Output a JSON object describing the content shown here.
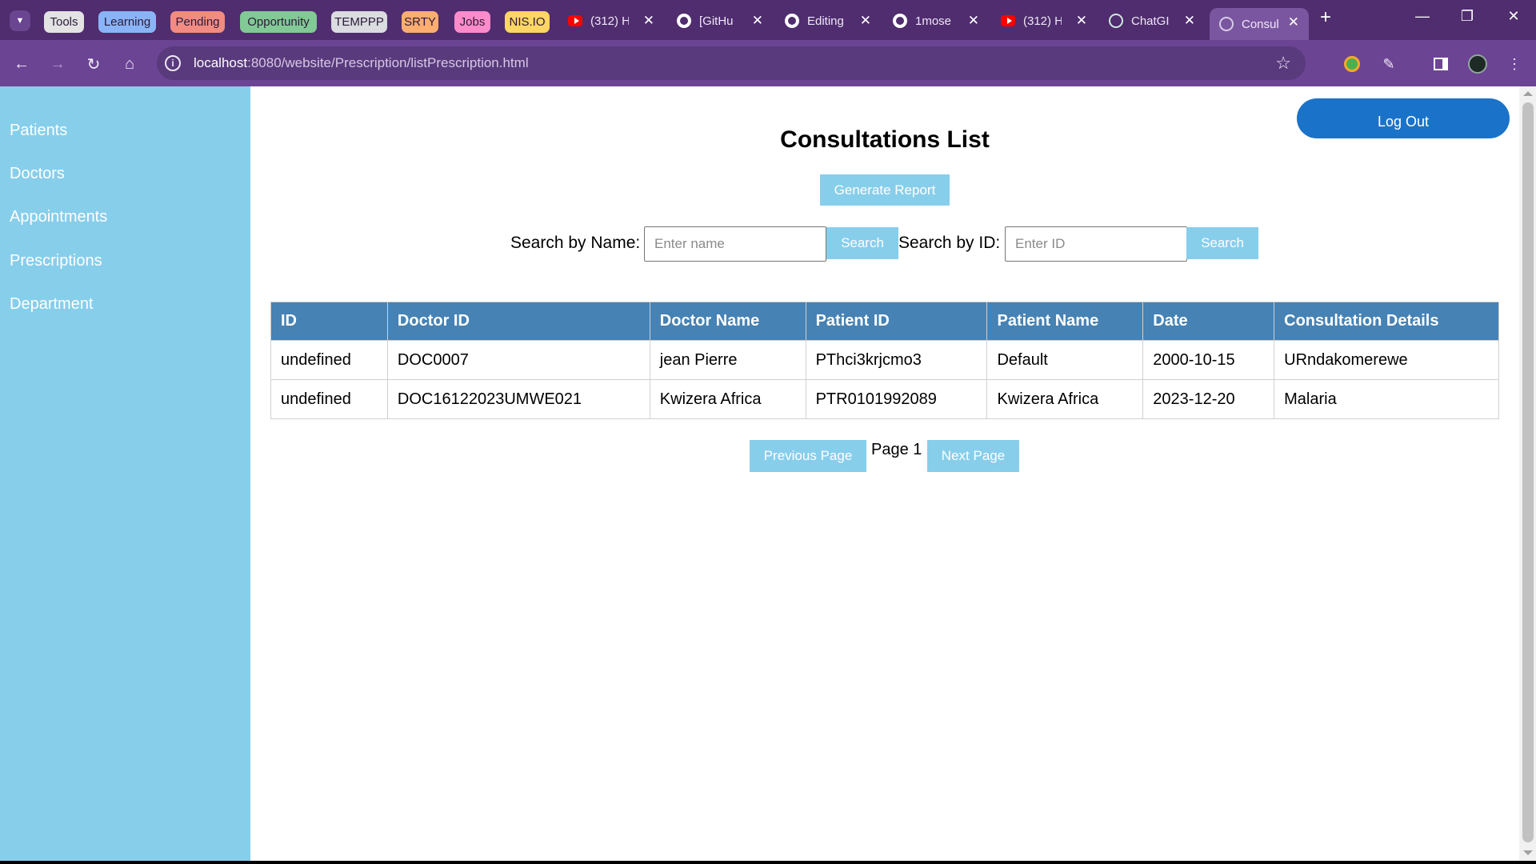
{
  "browser": {
    "tab_groups": [
      {
        "label": "Tools",
        "color": "#e3e3e3"
      },
      {
        "label": "Learning",
        "color": "#8ab4f8"
      },
      {
        "label": "Pending",
        "color": "#f28b82"
      },
      {
        "label": "Opportunity",
        "color": "#81c995"
      },
      {
        "label": "TEMPPP",
        "color": "#dadce0"
      },
      {
        "label": "SRTY",
        "color": "#fcad70"
      },
      {
        "label": "Jobs",
        "color": "#ff8bcb"
      },
      {
        "label": "NIS.IO",
        "color": "#fdd663"
      }
    ],
    "tabs": [
      {
        "title": "(312) H",
        "icon": "youtube-icon"
      },
      {
        "title": "[GitHu",
        "icon": "github-copilot-icon"
      },
      {
        "title": "Editing",
        "icon": "github-icon"
      },
      {
        "title": "1mose",
        "icon": "github-icon"
      },
      {
        "title": "(312) H",
        "icon": "youtube-icon"
      },
      {
        "title": "ChatGI",
        "icon": "chatgpt-icon"
      },
      {
        "title": "Consul",
        "icon": "globe-icon",
        "active": true
      }
    ],
    "url_host": "localhost",
    "url_path": ":8080/website/Prescription/listPrescription.html"
  },
  "sidebar": {
    "items": [
      {
        "label": "Patients"
      },
      {
        "label": "Doctors"
      },
      {
        "label": "Appointments"
      },
      {
        "label": "Prescriptions"
      },
      {
        "label": "Department"
      }
    ]
  },
  "header": {
    "logout_label": "Log Out",
    "title": "Consultations List",
    "report_label": "Generate Report"
  },
  "search": {
    "name_label": "Search by Name:",
    "name_placeholder": "Enter name",
    "name_button": "Search",
    "id_label": "Search by ID:",
    "id_placeholder": "Enter ID",
    "id_button": "Search"
  },
  "table": {
    "columns": [
      "ID",
      "Doctor ID",
      "Doctor Name",
      "Patient ID",
      "Patient Name",
      "Date",
      "Consultation Details"
    ],
    "rows": [
      [
        "undefined",
        "DOC0007",
        "jean Pierre",
        "PThci3krjcmo3",
        "Default",
        "2000-10-15",
        "URndakomerewe"
      ],
      [
        "undefined",
        "DOC16122023UMWE021",
        "Kwizera Africa",
        "PTR0101992089",
        "Kwizera Africa",
        "2023-12-20",
        "Malaria"
      ]
    ]
  },
  "pagination": {
    "prev_label": "Previous Page",
    "page_label": "Page 1",
    "next_label": "Next Page"
  },
  "colors": {
    "sidebar": "#87ceeb",
    "table_header": "#4682b4",
    "logout": "#1a73c9",
    "button": "#87ceeb"
  }
}
